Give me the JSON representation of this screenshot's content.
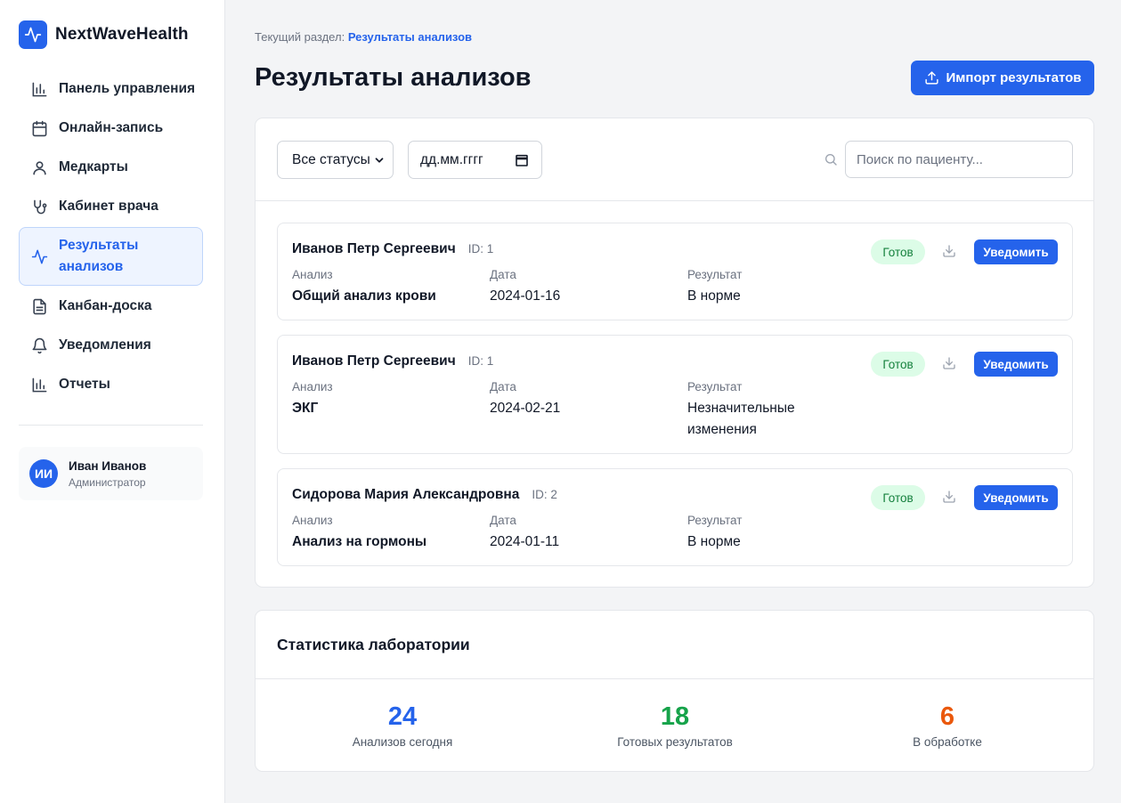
{
  "brand": {
    "name": "NextWaveHealth",
    "icon": "activity-icon",
    "color": "#2563eb"
  },
  "sidebar": {
    "items": [
      {
        "label": "Панель управления",
        "icon": "bar-chart-icon"
      },
      {
        "label": "Онлайн-запись",
        "icon": "calendar-icon"
      },
      {
        "label": "Медкарты",
        "icon": "user-icon"
      },
      {
        "label": "Кабинет врача",
        "icon": "stethoscope-icon"
      },
      {
        "label": "Результаты анализов",
        "icon": "activity-icon",
        "active": true
      },
      {
        "label": "Канбан-доска",
        "icon": "file-text-icon"
      },
      {
        "label": "Уведомления",
        "icon": "bell-icon"
      },
      {
        "label": "Отчеты",
        "icon": "bar-chart-icon"
      }
    ],
    "user": {
      "initials": "ИИ",
      "name": "Иван Иванов",
      "role": "Администратор"
    }
  },
  "header": {
    "breadcrumb_prefix": "Текущий раздел:",
    "breadcrumb_current": "Результаты анализов",
    "title": "Результаты анализов",
    "import_label": "Импорт результатов"
  },
  "filters": {
    "status_value": "Все статусы",
    "date_placeholder": "дд.мм.гггг",
    "search_placeholder": "Поиск по пациенту..."
  },
  "labels": {
    "analysis": "Анализ",
    "date": "Дата",
    "result": "Результат",
    "notify": "Уведомить"
  },
  "results": [
    {
      "patient": "Иванов Петр Сергеевич",
      "id": "ID: 1",
      "analysis": "Общий анализ крови",
      "date": "2024-01-16",
      "result": "В норме",
      "status": "Готов"
    },
    {
      "patient": "Иванов Петр Сергеевич",
      "id": "ID: 1",
      "analysis": "ЭКГ",
      "date": "2024-02-21",
      "result": "Незначительные изменения",
      "status": "Готов"
    },
    {
      "patient": "Сидорова Мария Александровна",
      "id": "ID: 2",
      "analysis": "Анализ на гормоны",
      "date": "2024-01-11",
      "result": "В норме",
      "status": "Готов"
    }
  ],
  "stats": {
    "title": "Статистика лаборатории",
    "items": [
      {
        "value": "24",
        "caption": "Анализов сегодня",
        "color": "#2563eb"
      },
      {
        "value": "18",
        "caption": "Готовых результатов",
        "color": "#16a34a"
      },
      {
        "value": "6",
        "caption": "В обработке",
        "color": "#ea580c"
      }
    ]
  }
}
